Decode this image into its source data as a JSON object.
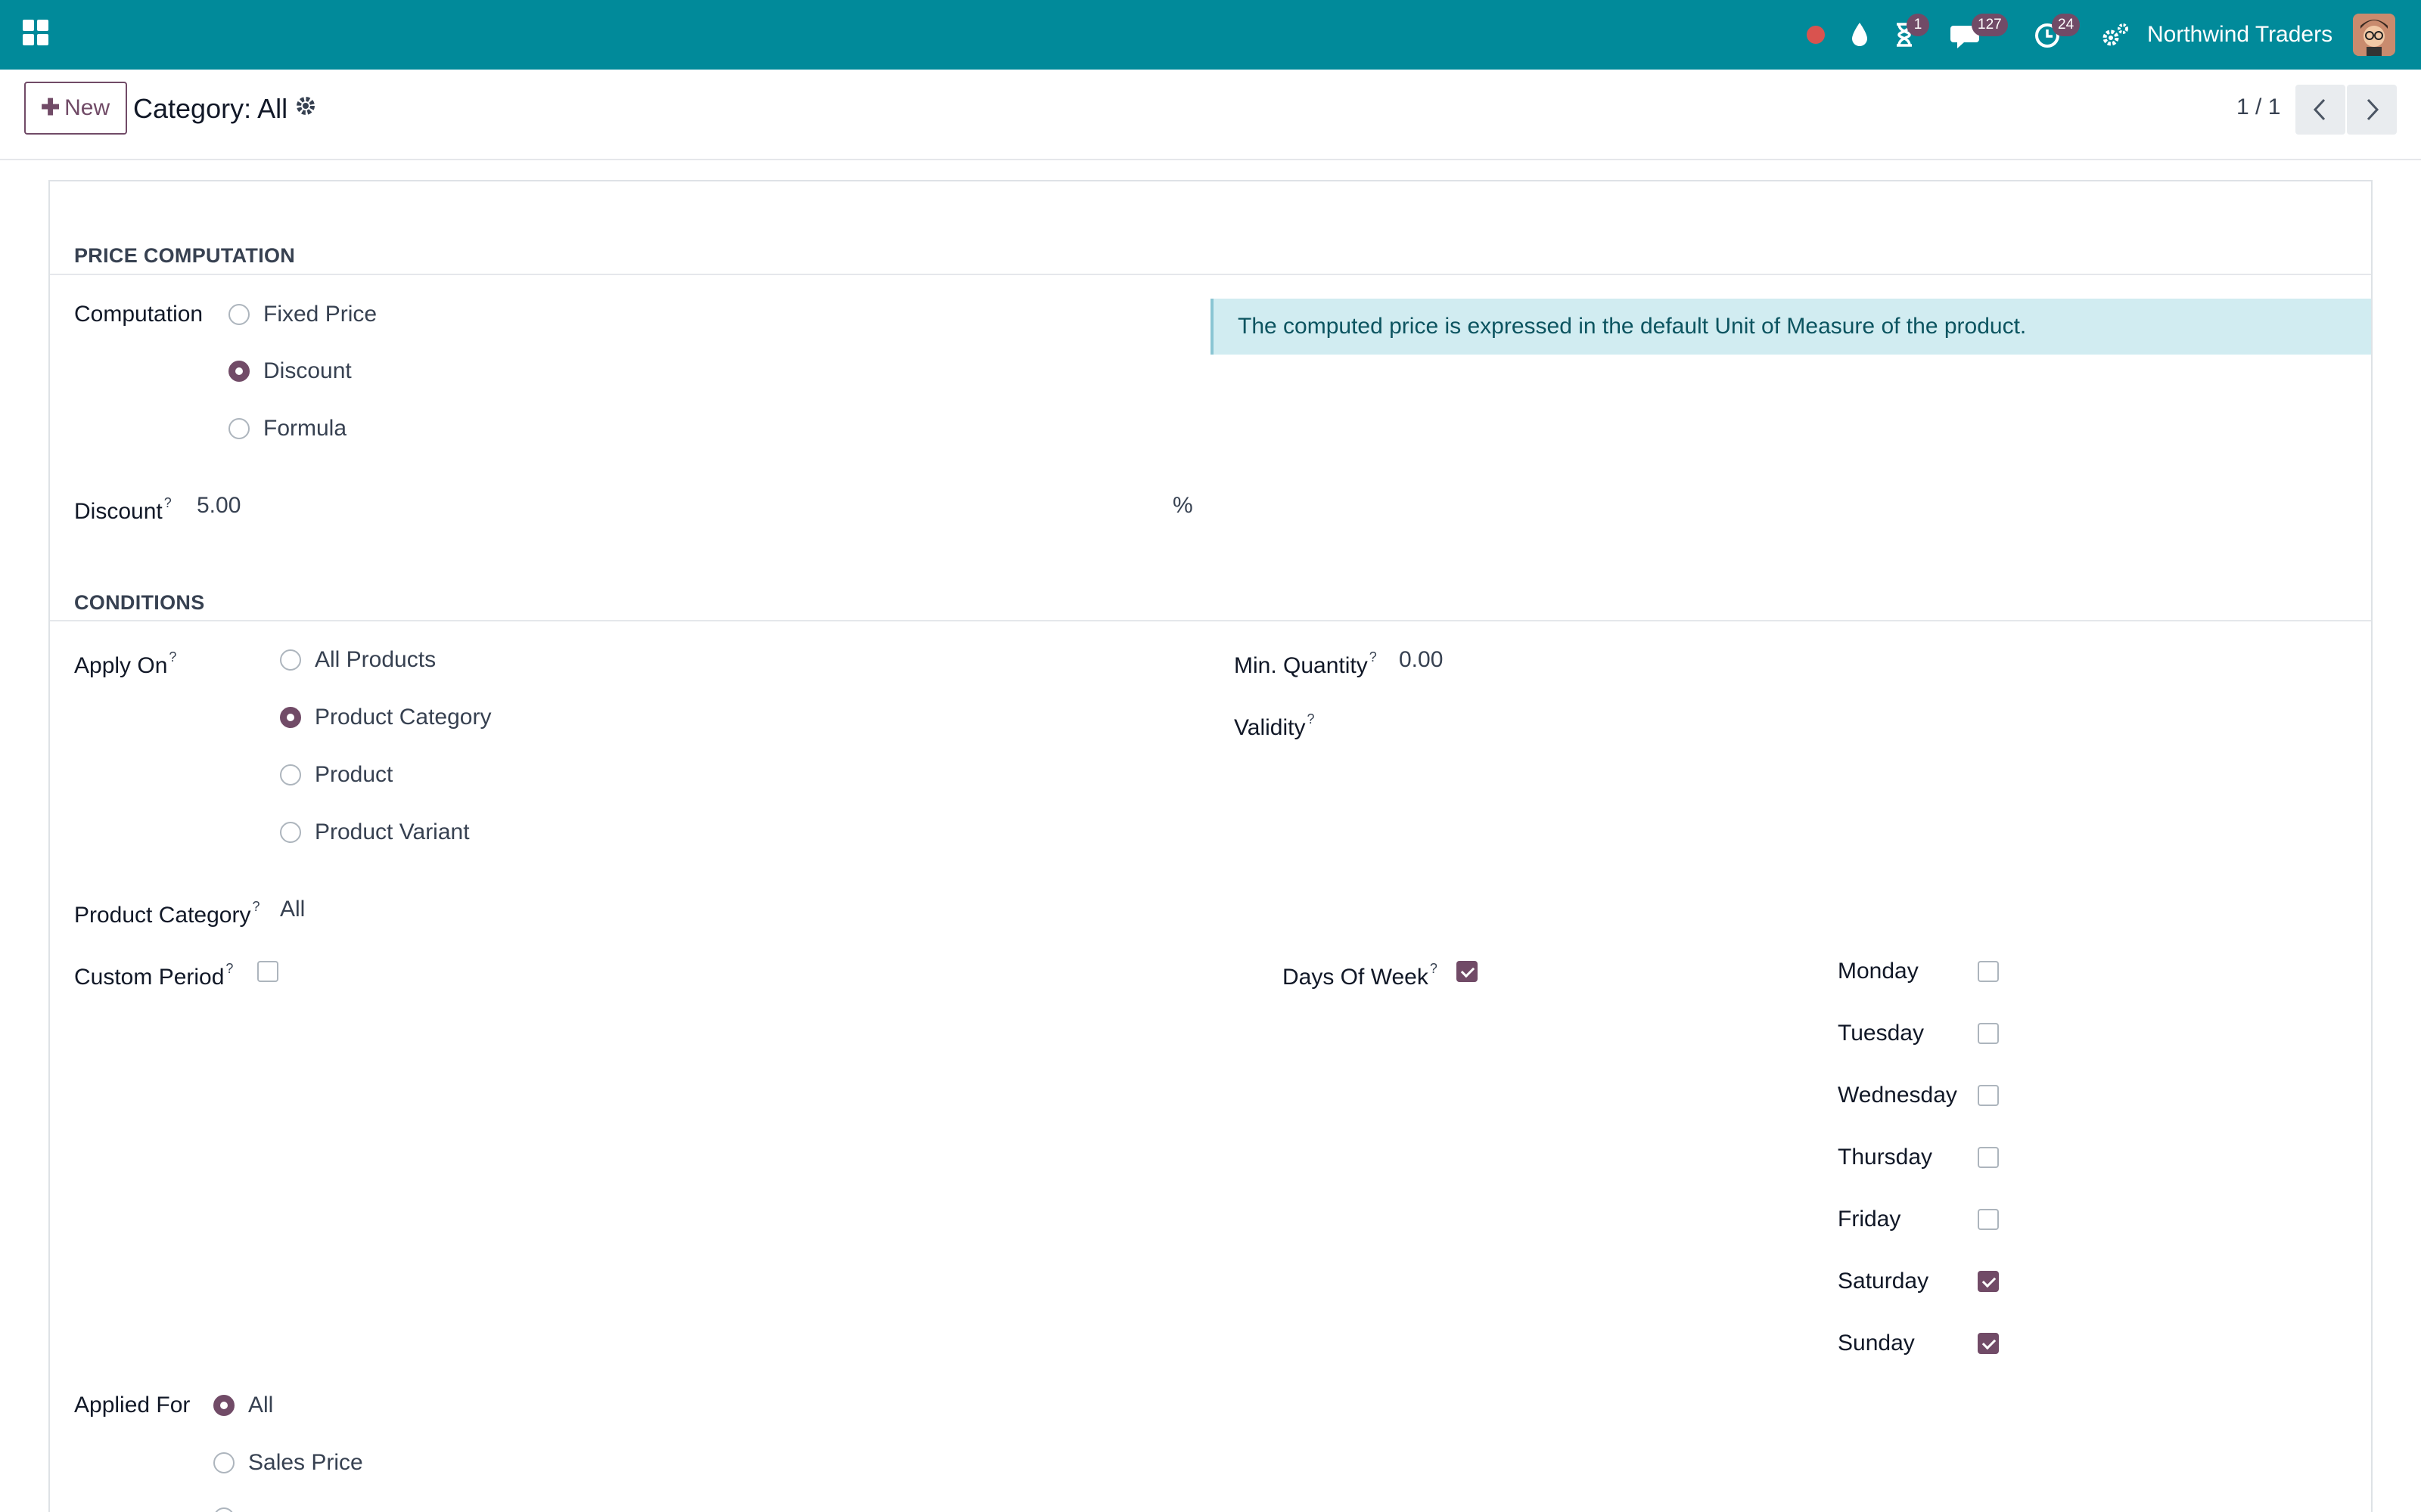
{
  "navbar": {
    "company": "Northwind Traders",
    "activity_count": "1",
    "messages_count": "127",
    "updates_count": "24",
    "colors": {
      "navbar_bg": "#018a9a",
      "badge": "#714b67",
      "record_dot": "#d9534f"
    }
  },
  "control_panel": {
    "new_label": "New",
    "breadcrumb": "Category: All",
    "pager_value": "1 / 1"
  },
  "price_computation": {
    "section_title": "PRICE COMPUTATION",
    "computation_label": "Computation",
    "options": [
      {
        "label": "Fixed Price",
        "selected": false
      },
      {
        "label": "Discount",
        "selected": true
      },
      {
        "label": "Formula",
        "selected": false
      }
    ],
    "discount_label": "Discount",
    "discount_value": "5.00",
    "discount_unit": "%",
    "info": "The computed price is expressed in the default Unit of Measure of the product."
  },
  "conditions": {
    "section_title": "CONDITIONS",
    "apply_on_label": "Apply On",
    "apply_on_options": [
      {
        "label": "All Products",
        "selected": false
      },
      {
        "label": "Product Category",
        "selected": true
      },
      {
        "label": "Product",
        "selected": false
      },
      {
        "label": "Product Variant",
        "selected": false
      }
    ],
    "min_quantity_label": "Min. Quantity",
    "min_quantity_value": "0.00",
    "validity_label": "Validity",
    "product_category_label": "Product Category",
    "product_category_value": "All",
    "custom_period_label": "Custom Period",
    "custom_period_checked": false,
    "days_of_week_label": "Days Of Week",
    "days_of_week_checked": true,
    "days": [
      {
        "label": "Monday",
        "checked": false
      },
      {
        "label": "Tuesday",
        "checked": false
      },
      {
        "label": "Wednesday",
        "checked": false
      },
      {
        "label": "Thursday",
        "checked": false
      },
      {
        "label": "Friday",
        "checked": false
      },
      {
        "label": "Saturday",
        "checked": true
      },
      {
        "label": "Sunday",
        "checked": true
      }
    ],
    "applied_for_label": "Applied For",
    "applied_for_options": [
      {
        "label": "All",
        "selected": true
      },
      {
        "label": "Sales Price",
        "selected": false
      }
    ]
  },
  "help_marker": "?"
}
